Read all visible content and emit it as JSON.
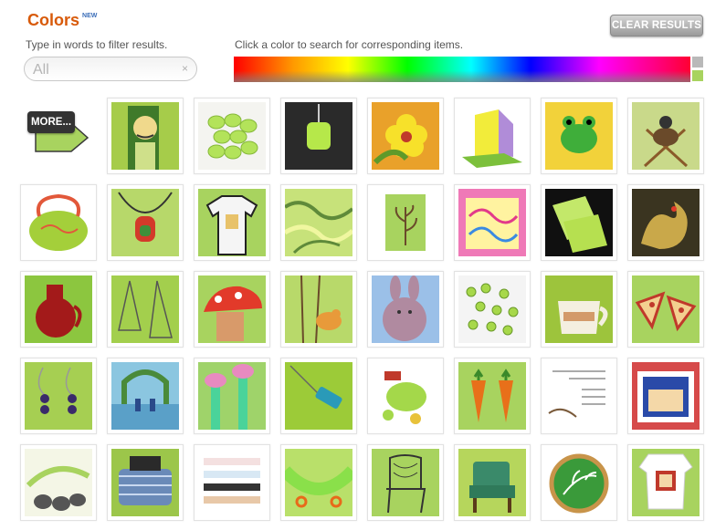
{
  "header": {
    "title": "Colors",
    "badge": "NEW",
    "clear_button": "CLEAR RESULTS"
  },
  "filter": {
    "label": "Type in words to filter results.",
    "placeholder": "All",
    "clear_symbol": "×"
  },
  "color_picker": {
    "label": "Click a color to search for corresponding items.",
    "swatches": [
      "#b9b9b9",
      "#a8d35f"
    ]
  },
  "more_button": {
    "label": "MORE..."
  },
  "accent_colors": {
    "title": "#d85a0a",
    "lime": "#a8d35f"
  },
  "items": [
    {
      "icon": "illustrated-man-icon",
      "bg": "#a6cc4a",
      "art": "man"
    },
    {
      "icon": "green-beads-icon",
      "bg": "#f4f4f0",
      "art": "beads"
    },
    {
      "icon": "green-pendant-icon",
      "bg": "#2a2a2a",
      "art": "pendant"
    },
    {
      "icon": "yellow-flower-print-icon",
      "bg": "#e9a12a",
      "art": "flower"
    },
    {
      "icon": "folded-card-icon",
      "bg": "#ffffff",
      "art": "card"
    },
    {
      "icon": "crochet-frog-icon",
      "bg": "#f2d23a",
      "art": "frog"
    },
    {
      "icon": "bug-on-sticks-icon",
      "bg": "#c9d98a",
      "art": "bug"
    },
    {
      "icon": "felt-bag-icon",
      "bg": "#ffffff",
      "art": "bag"
    },
    {
      "icon": "red-pendant-necklace-icon",
      "bg": "#b7d86a",
      "art": "necklace"
    },
    {
      "icon": "raglan-shirt-icon",
      "bg": "#a8d35f",
      "art": "shirt"
    },
    {
      "icon": "marbled-paper-icon",
      "bg": "#c7e27a",
      "art": "marble"
    },
    {
      "icon": "leaf-print-icon",
      "bg": "#ffffff",
      "art": "leaf"
    },
    {
      "icon": "pink-embroidery-icon",
      "bg": "#ef79b7",
      "art": "embroidery"
    },
    {
      "icon": "green-cards-icon",
      "bg": "#101010",
      "art": "cards"
    },
    {
      "icon": "dragon-painting-icon",
      "bg": "#3a3420",
      "art": "dragon"
    },
    {
      "icon": "red-glass-jug-icon",
      "bg": "#8cc63f",
      "art": "jug"
    },
    {
      "icon": "wire-earrings-icon",
      "bg": "#a3cf4d",
      "art": "wire"
    },
    {
      "icon": "mushroom-creature-icon",
      "bg": "#a8d35f",
      "art": "mushroom"
    },
    {
      "icon": "bird-on-branch-icon",
      "bg": "#b8d96a",
      "art": "bird"
    },
    {
      "icon": "knitted-bunny-icon",
      "bg": "#9bc0e8",
      "art": "bunny"
    },
    {
      "icon": "green-glass-beads-icon",
      "bg": "#f4f4f4",
      "art": "glassbeads"
    },
    {
      "icon": "ceramic-cup-icon",
      "bg": "#9dc43c",
      "art": "cup"
    },
    {
      "icon": "pizza-earrings-icon",
      "bg": "#a8d35f",
      "art": "pizza"
    },
    {
      "icon": "purple-bead-earrings-icon",
      "bg": "#a6cf52",
      "art": "earrings"
    },
    {
      "icon": "wedding-arch-icon",
      "bg": "#8bc6e0",
      "art": "arch"
    },
    {
      "icon": "tree-illustration-icon",
      "bg": "#9fd36a",
      "art": "trees"
    },
    {
      "icon": "blue-pendant-icon",
      "bg": "#9ccb38",
      "art": "bluependant"
    },
    {
      "icon": "green-soap-icon",
      "bg": "#ffffff",
      "art": "soap"
    },
    {
      "icon": "carrot-earrings-icon",
      "bg": "#a8d35f",
      "art": "carrots"
    },
    {
      "icon": "handwritten-card-icon",
      "bg": "#ffffff",
      "art": "textcard"
    },
    {
      "icon": "flag-box-icon",
      "bg": "#d64a4a",
      "art": "flagbox"
    },
    {
      "icon": "bird-drawing-icon",
      "bg": "#f4f6e6",
      "art": "birds"
    },
    {
      "icon": "woven-pouch-icon",
      "bg": "#9cc64a",
      "art": "pouch"
    },
    {
      "icon": "fabric-labels-icon",
      "bg": "#ffffff",
      "art": "labels"
    },
    {
      "icon": "green-collar-icon",
      "bg": "#b9e06a",
      "art": "collar"
    },
    {
      "icon": "chair-drawing-icon",
      "bg": "#a8d35f",
      "art": "chair"
    },
    {
      "icon": "green-armchair-icon",
      "bg": "#b6d65c",
      "art": "armchair"
    },
    {
      "icon": "embroidery-hoop-icon",
      "bg": "#ffffff",
      "art": "hoop"
    },
    {
      "icon": "baby-onesie-icon",
      "bg": "#a8d35f",
      "art": "onesie"
    }
  ]
}
